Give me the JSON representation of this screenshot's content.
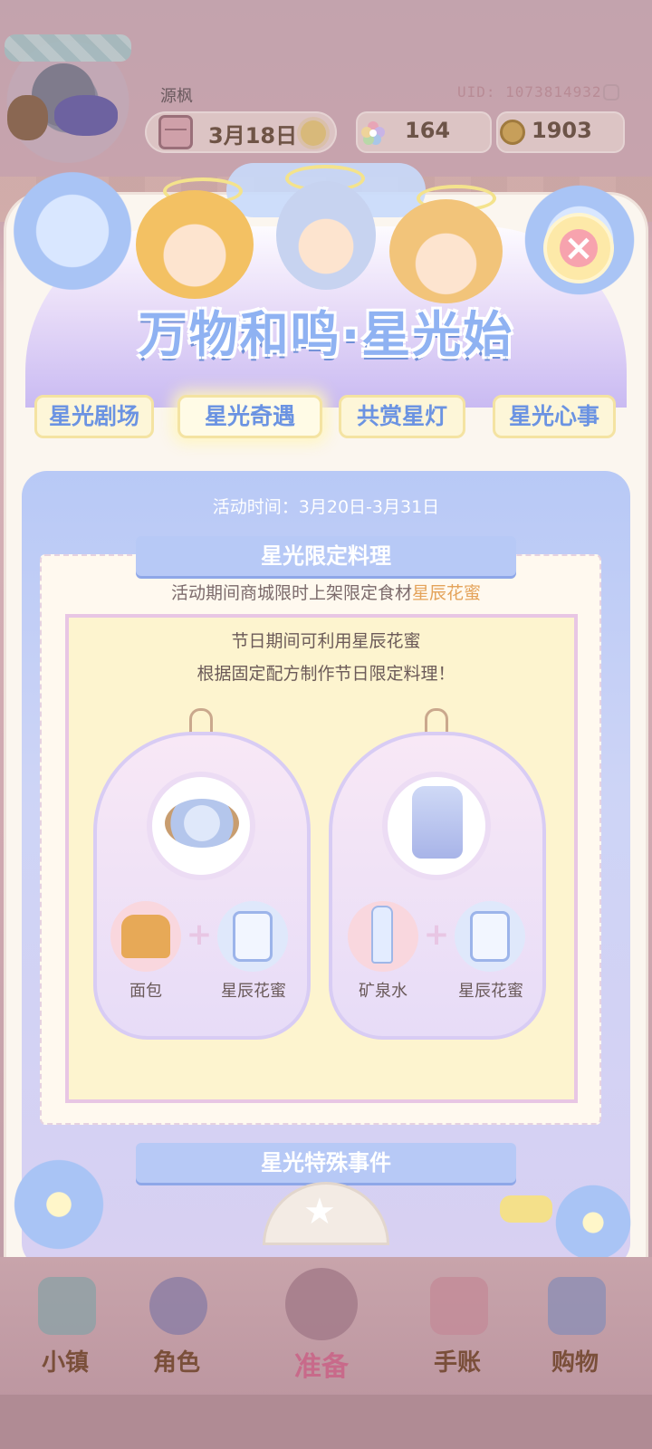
{
  "player": {
    "name": "源枫",
    "uid": "UID: 1073814932"
  },
  "status": {
    "date": "3月18日",
    "weather_icon": "sun-icon",
    "gems": "164",
    "coins": "1903"
  },
  "event": {
    "title": "万物和鸣·星光始",
    "close_icon": "close-x-icon",
    "tabs": [
      "星光剧场",
      "星光奇遇",
      "共赏星灯",
      "星光心事"
    ],
    "active_tab": "星光奇遇"
  },
  "section1": {
    "time": "活动时间：3月20日-3月31日",
    "heading": "星光限定料理",
    "desc_prefix": "活动期间商城限时上架限定食材",
    "desc_highlight": "星辰花蜜",
    "inner_line1": "节日期间可利用星辰花蜜",
    "inner_line2": "根据固定配方制作节日限定料理！",
    "recipes": [
      {
        "ingredients": [
          "面包",
          "星辰花蜜"
        ]
      },
      {
        "ingredients": [
          "矿泉水",
          "星辰花蜜"
        ]
      }
    ]
  },
  "section2": {
    "heading": "星光特殊事件"
  },
  "nav": {
    "items": [
      "小镇",
      "角色",
      "准备",
      "手账",
      "购物"
    ]
  },
  "colors": {
    "accent_blue": "#8fb2f2",
    "highlight_orange": "#e4a35a",
    "tab_text": "#6b93e2"
  }
}
